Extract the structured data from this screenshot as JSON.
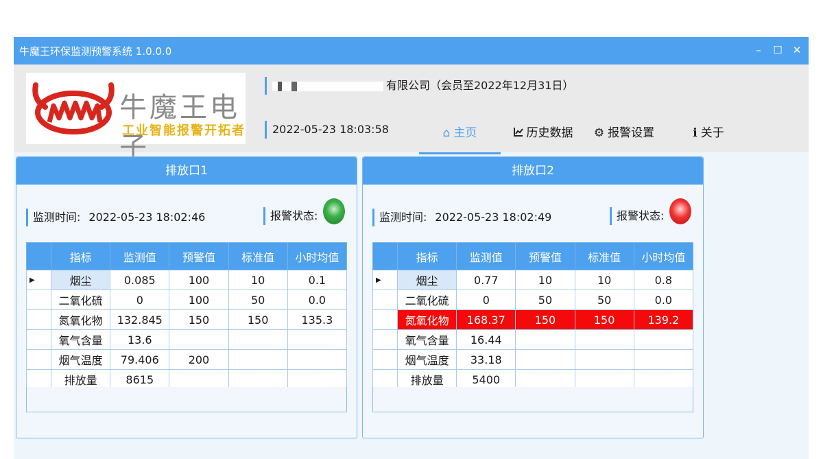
{
  "app": {
    "title": "牛魔王环保监测预警系统 1.0.0.0",
    "controls": {
      "minimize": "–",
      "maximize": "☐",
      "close": "✕"
    }
  },
  "header": {
    "logo": {
      "main": "牛魔王电子",
      "sub": "工业智能报警开拓者"
    },
    "company_suffix": "有限公司（会员至2022年12月31日）",
    "datetime": "2022-05-23 18:03:58"
  },
  "nav": [
    {
      "icon": "home-icon",
      "glyph": "⌂",
      "label": "主页",
      "active": true
    },
    {
      "icon": "line-chart-icon",
      "glyph": "📈",
      "label": "历史数据",
      "active": false
    },
    {
      "icon": "gear-icon",
      "glyph": "⚙",
      "label": "报警设置",
      "active": false
    },
    {
      "icon": "info-icon",
      "glyph": "ℹ",
      "label": "关于",
      "active": false
    }
  ],
  "labels": {
    "monitor_time": "监测时间:",
    "alarm_status": "报警状态:"
  },
  "columns": [
    "指标",
    "监测值",
    "预警值",
    "标准值",
    "小时均值"
  ],
  "panels": [
    {
      "title": "排放口1",
      "monitor_time": "2022-05-23 18:02:46",
      "status": "green",
      "rows": [
        {
          "name": "烟尘",
          "value": "0.085",
          "warn": "100",
          "std": "10",
          "avg": "0.1",
          "alarm": false
        },
        {
          "name": "二氧化硫",
          "value": "0",
          "warn": "100",
          "std": "50",
          "avg": "0.0",
          "alarm": false
        },
        {
          "name": "氮氧化物",
          "value": "132.845",
          "warn": "150",
          "std": "150",
          "avg": "135.3",
          "alarm": false
        },
        {
          "name": "氧气含量",
          "value": "13.6",
          "warn": "",
          "std": "",
          "avg": "",
          "alarm": false
        },
        {
          "name": "烟气温度",
          "value": "79.406",
          "warn": "200",
          "std": "",
          "avg": "",
          "alarm": false
        },
        {
          "name": "排放量",
          "value": "8615",
          "warn": "",
          "std": "",
          "avg": "",
          "alarm": false
        }
      ]
    },
    {
      "title": "排放口2",
      "monitor_time": "2022-05-23 18:02:49",
      "status": "red",
      "rows": [
        {
          "name": "烟尘",
          "value": "0.77",
          "warn": "10",
          "std": "10",
          "avg": "0.8",
          "alarm": false
        },
        {
          "name": "二氧化硫",
          "value": "0",
          "warn": "50",
          "std": "50",
          "avg": "0.0",
          "alarm": false
        },
        {
          "name": "氮氧化物",
          "value": "168.37",
          "warn": "150",
          "std": "150",
          "avg": "139.2",
          "alarm": true
        },
        {
          "name": "氧气含量",
          "value": "16.44",
          "warn": "",
          "std": "",
          "avg": "",
          "alarm": false
        },
        {
          "name": "烟气温度",
          "value": "33.18",
          "warn": "",
          "std": "",
          "avg": "",
          "alarm": false
        },
        {
          "name": "排放量",
          "value": "5400",
          "warn": "",
          "std": "",
          "avg": "",
          "alarm": false
        }
      ]
    }
  ],
  "colors": {
    "accent": "#4da1ee",
    "alarm": "#f40a0a",
    "ok": "#3cb04a"
  }
}
